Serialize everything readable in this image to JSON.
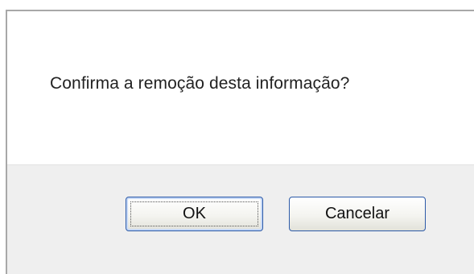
{
  "dialog": {
    "message": "Confirma a remoção desta informação?",
    "buttons": {
      "ok_label": "OK",
      "cancel_label": "Cancelar"
    }
  },
  "colors": {
    "button_border": "#2c5aa8",
    "footer_background": "#efefef",
    "dialog_background": "#ffffff"
  }
}
